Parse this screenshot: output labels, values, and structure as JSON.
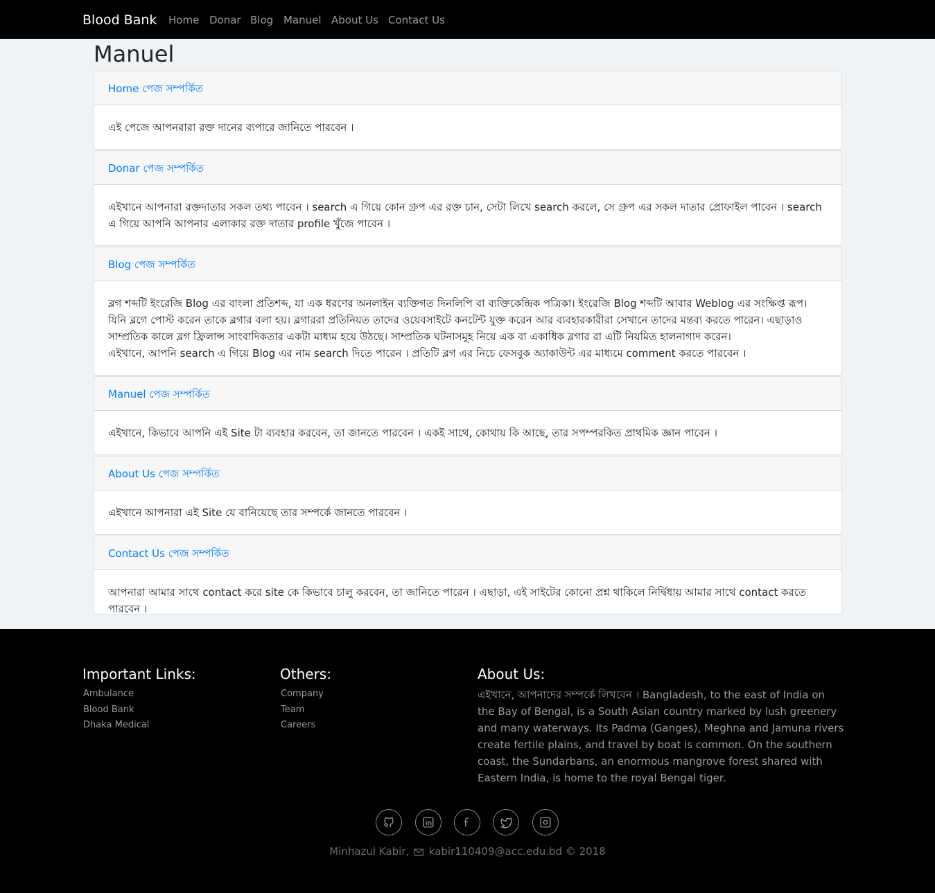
{
  "navbar": {
    "brand": "Blood Bank",
    "links": [
      "Home",
      "Donar",
      "Blog",
      "Manuel",
      "About Us",
      "Contact Us"
    ]
  },
  "page": {
    "title": "Manuel"
  },
  "cards": [
    {
      "header": "Home পেজ সম্পর্কিত",
      "body": "এই পেজে আপনরারা রক্ত দানের ব্যপারে জানিতে পারবেন ।"
    },
    {
      "header": "Donar পেজ সম্পর্কিত",
      "body": "এইখানে আপনারা রক্তদাতার সকল তথ্য পাবেন । search এ গিয়ে কোন গ্রুপ এর রক্ত চান, সেটা লিখে search করলে, সে গ্রুপ এর সকল দাতার প্রোফাইল পাবেন । search এ গিয়ে আপনি আপনার এলাকার রক্ত দাতার profile খুঁজে পাবেন ।"
    },
    {
      "header": "Blog পেজ সম্পর্কিত",
      "body": "ব্লগ শব্দটি ইংরেজি Blog এর বাংলা প্রতিশব্দ, যা এক ধরণের অনলাইন ব্যক্তিগত দিনলিপি বা ব্যক্তিকেন্দ্রিক পত্রিকা। ইংরেজি Blog শব্দটি আবার Weblog এর সংক্ষিপ্ত রূপ। যিনি ব্লগে পোস্ট করেন তাকে ব্লগার বলা হয়। ব্লগাররা প্রতিনিয়ত তাদের ওয়েবসাইটে কনটেন্ট যুক্ত করেন আর ব্যবহারকারীরা সেখানে তাদের মন্তব্য করতে পারেন। এছাড়াও সাম্প্রতিক কালে ব্লগ ফ্রিলান্স সাংবাদিকতার একটা মাধ্যম হয়ে উঠছে। সাম্প্রতিক ঘটনাসমূহ নিয়ে এক বা একাধিক ব্লগার রা এটি নিয়মিত হালনাগাদ করেন।\nএইখানে, আপনি search এ গিয়ে Blog এর নাম search দিতে পারেন । প্রতিটি ব্লগ এর নিচে ফেসবুক অ্যাকাউন্ট এর মাধ্যমে comment করতে পারবেন ।"
    },
    {
      "header": "Manuel পেজ সম্পর্কিত",
      "body": "এইখানে, কিভাবে আপনি এই Site টা ব্যবহার করবেন, তা জানতে পারবেন । একই সাথে, কোথায় কি আছে, তার সপম্পরকিত প্রাথমিক জ্ঞান পাবেন ।"
    },
    {
      "header": "About Us পেজ সম্পর্কিত",
      "body": "এইখানে আপনারা এই Site যে বানিয়েছে তার সম্পর্কে জানতে পারবেন ।"
    },
    {
      "header": "Contact Us পেজ সম্পর্কিত",
      "body": "আপনারা আমার সাথে contact করে site কে কিভাবে চালু করবেন, তা জানিতে পারেন । এছাড়া, এই সাইটের কোনো প্রশ্ন থাকিলে নির্দ্বিধায় আমার সাথে contact করতে পারবেন ।"
    }
  ],
  "footer": {
    "important_links": {
      "title": "Important Links:",
      "items": [
        "Ambulance",
        "Blood Bank",
        "Dhaka Medical"
      ]
    },
    "others": {
      "title": "Others:",
      "items": [
        "Company",
        "Team",
        "Careers"
      ]
    },
    "about": {
      "title": "About Us:",
      "text": "এইখানে, আপনাদের সম্পর্কে লিখবেন । Bangladesh, to the east of India on the Bay of Bengal, is a South Asian country marked by lush greenery and many waterways. Its Padma (Ganges), Meghna and Jamuna rivers create fertile plains, and travel by boat is common. On the southern coast, the Sundarbans, an enormous mangrove forest shared with Eastern India, is home to the royal Bengal tiger."
    },
    "social_icons": [
      "github-icon",
      "linkedin-icon",
      "facebook-icon",
      "twitter-icon",
      "instagram-icon"
    ],
    "copyright": {
      "name": "Minhazul Kabir,",
      "email": "kabir110409@acc.edu.bd",
      "year": "© 2018"
    }
  },
  "colors": {
    "navbar_bg": "#000000",
    "page_bg": "#eff3f6",
    "link_blue": "#007bff",
    "footer_bg": "#000000"
  }
}
